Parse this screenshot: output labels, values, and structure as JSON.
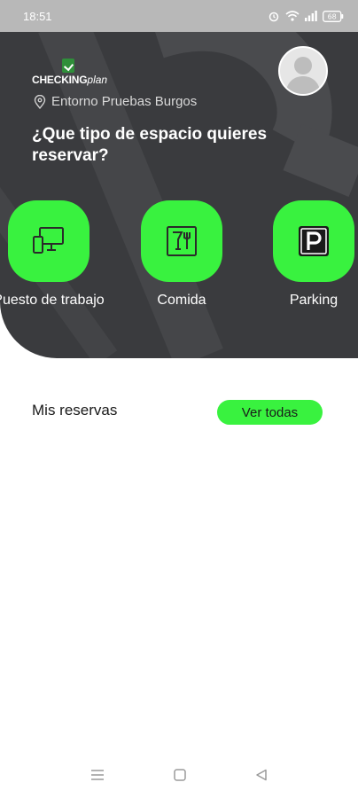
{
  "status_bar": {
    "time": "18:51",
    "battery_level": "68",
    "icons": [
      "alarm-icon",
      "wifi-icon",
      "signal-icon",
      "battery-icon"
    ]
  },
  "brand": {
    "logo_bold": "CHECKING",
    "logo_italic": "plan",
    "accent_color": "#39f23f",
    "logo_color": "#2f8f3a",
    "hero_color": "#3a3b3e"
  },
  "location": {
    "icon": "location-pin-icon",
    "name": "Entorno Pruebas Burgos"
  },
  "question": "¿Que tipo de espacio quieres reservar?",
  "categories": [
    {
      "label": "Puesto de trabajo",
      "icon": "workstation-icon"
    },
    {
      "label": "Comida",
      "icon": "food-icon"
    },
    {
      "label": "Parking",
      "icon": "parking-icon"
    }
  ],
  "reservations": {
    "title": "Mis reservas",
    "view_all_label": "Ver todas"
  },
  "nav_bar": {
    "icons": [
      "menu-icon",
      "home-icon",
      "back-icon"
    ]
  }
}
